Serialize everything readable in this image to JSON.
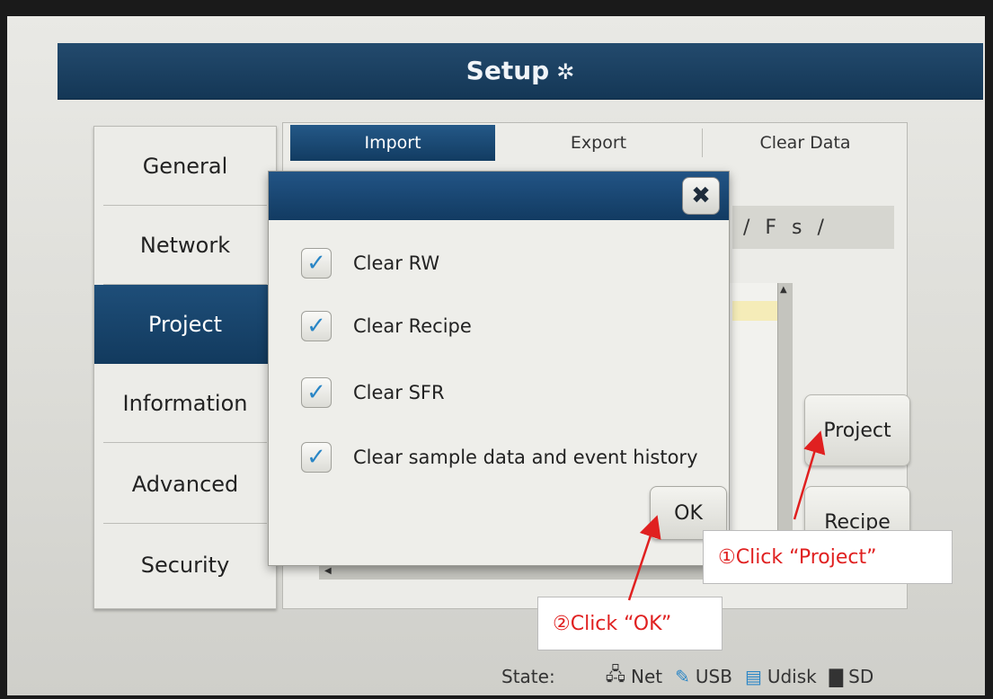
{
  "header": {
    "title": "Setup",
    "icon": "gear-icon"
  },
  "sidebar": {
    "items": [
      {
        "label": "General"
      },
      {
        "label": "Network"
      },
      {
        "label": "Project",
        "active": true
      },
      {
        "label": "Information"
      },
      {
        "label": "Advanced"
      },
      {
        "label": "Security"
      }
    ]
  },
  "tabs": [
    {
      "label": "Import",
      "active": true
    },
    {
      "label": "Export"
    },
    {
      "label": "Clear Data"
    }
  ],
  "path": {
    "text": "/ F s /"
  },
  "buttons": {
    "project": "Project",
    "recipe": "Recipe"
  },
  "dialog": {
    "close_icon": "close-icon",
    "options": [
      {
        "label": "Clear RW",
        "checked": true
      },
      {
        "label": "Clear Recipe",
        "checked": true
      },
      {
        "label": "Clear SFR",
        "checked": true
      },
      {
        "label": "Clear sample data and event history",
        "checked": true
      }
    ],
    "ok_label": "OK"
  },
  "status": {
    "label": "State:",
    "items": [
      {
        "icon": "network-icon",
        "label": "Net"
      },
      {
        "icon": "usb-icon",
        "label": "USB"
      },
      {
        "icon": "udisk-icon",
        "label": "Udisk"
      },
      {
        "icon": "sd-card-icon",
        "label": "SD"
      }
    ]
  },
  "callouts": {
    "step1": "①Click “Project”",
    "step2": "②Click “OK”"
  },
  "colors": {
    "accent": "#1e4e79",
    "annotation": "#e02020",
    "check": "#2a86c6"
  }
}
